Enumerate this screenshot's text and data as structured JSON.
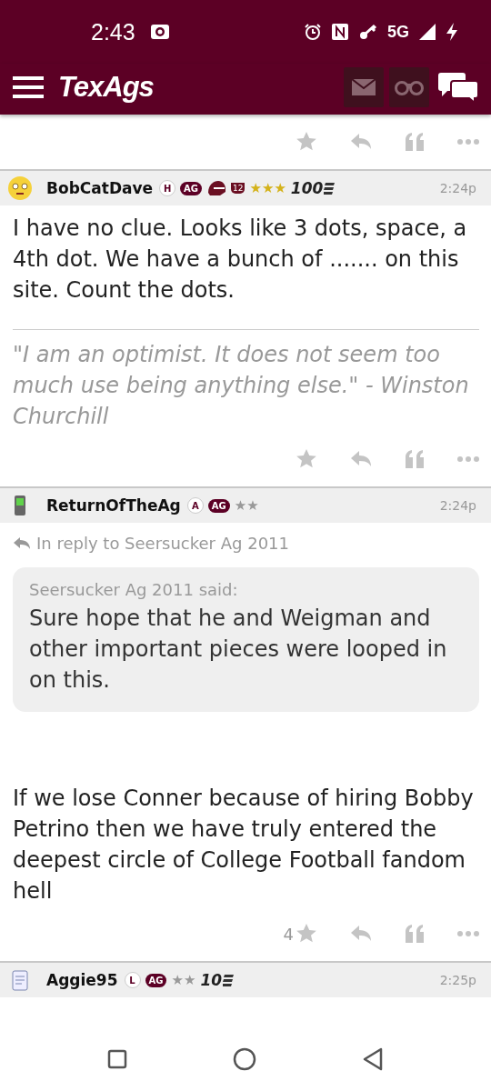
{
  "status_bar": {
    "time": "2:43",
    "network": "5G"
  },
  "header": {
    "logo": "TexAgs"
  },
  "posts": [
    {
      "kind": "tail"
    },
    {
      "kind": "post",
      "avatar": {
        "kind": "face"
      },
      "username": "BobCatDave",
      "letter": "H",
      "ag": "AG",
      "emblems": [
        {
          "kind": "helmet"
        },
        {
          "kind": "shield",
          "text": "12"
        }
      ],
      "rank": "★★★",
      "color": "#d4b21a",
      "count": "100",
      "time": "2:24p",
      "body": "I have no clue. Looks like 3 dots, space, a 4th dot. We have a bunch of ....... on this site. Count the dots.",
      "signature": "\"I am an optimist. It does not seem too much use being anything else.\" - Winston Churchill"
    },
    {
      "kind": "post",
      "avatar": {
        "kind": "phone"
      },
      "username": "ReturnOfTheAg",
      "letter": "A",
      "ag": "AG",
      "rank": "★★",
      "color": "#999999",
      "time": "2:24p",
      "reply_to": "In reply to Seersucker Ag 2011",
      "quote_author": "Seersucker Ag 2011 said:",
      "quote": "Sure hope that he and Weigman and other important pieces were looped in on this.",
      "body": "If we lose Conner because of hiring Bobby Petrino then we have truly entered the deepest circle of College Football fandom hell",
      "likes": "4"
    },
    {
      "kind": "head",
      "avatar": {
        "kind": "notepad"
      },
      "username": "Aggie95",
      "letter": "L",
      "ag": "AG",
      "rank": "★★",
      "color": "#999999",
      "count": "10",
      "time": "2:25p"
    }
  ]
}
